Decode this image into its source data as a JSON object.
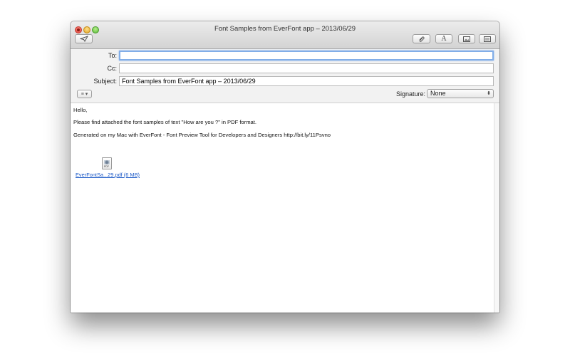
{
  "window": {
    "title": "Font Samples from EverFont app – 2013/06/29"
  },
  "toolbar": {
    "send_icon": "paper-plane-icon",
    "attach_icon": "paperclip-icon",
    "format_label": "A",
    "photo_icon": "photo-icon",
    "template_icon": "stationery-icon"
  },
  "headers": {
    "to_label": "To:",
    "to_value": "",
    "cc_label": "Cc:",
    "cc_value": "",
    "subject_label": "Subject:",
    "subject_value": "Font Samples from EverFont app – 2013/06/29"
  },
  "options": {
    "format_menu_label": "≡ ▾",
    "signature_label": "Signature:",
    "signature_value": "None"
  },
  "message": {
    "line1": "Hello,",
    "line2": "Please find attached the font samples of text \"How are you ?\" in PDF format.",
    "line3": "Generated on my Mac with EverFont - Font Preview Tool for Developers and Designers http://bit.ly/11Psvno"
  },
  "attachment": {
    "icon_text": "PDF",
    "filename": "EverFontSa...29.pdf (6 MB)"
  },
  "colors": {
    "link": "#1a58c7",
    "focus": "#82aee8"
  }
}
